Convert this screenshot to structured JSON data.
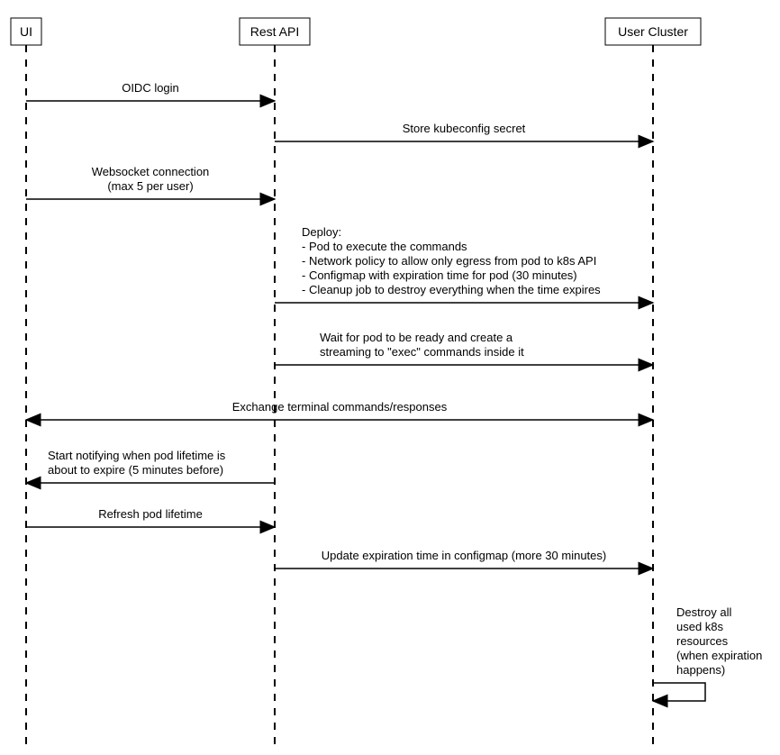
{
  "actors": {
    "ui": "UI",
    "api": "Rest API",
    "cluster": "User Cluster"
  },
  "messages": {
    "oidc": "OIDC login",
    "store_secret": "Store kubeconfig secret",
    "ws1": "Websocket connection",
    "ws2": "(max 5 per user)",
    "deploy_h": "Deploy:",
    "deploy_1": "- Pod to execute the commands",
    "deploy_2": "- Network policy to allow only egress from pod to k8s API",
    "deploy_3": "- Configmap with expiration time for pod (30 minutes)",
    "deploy_4": "- Cleanup job to destroy everything when the time expires",
    "wait_1": "Wait for pod to be ready and create a",
    "wait_2": "streaming to \"exec\" commands inside it",
    "exchange": "Exchange terminal commands/responses",
    "notify_1": "Start notifying when pod lifetime is",
    "notify_2": "about to expire (5 minutes before)",
    "refresh": "Refresh pod lifetime",
    "update": "Update expiration time in configmap (more 30 minutes)",
    "destroy_1": "Destroy all",
    "destroy_2": "used k8s",
    "destroy_3": "resources",
    "destroy_4": "(when expiration",
    "destroy_5": "happens)"
  }
}
